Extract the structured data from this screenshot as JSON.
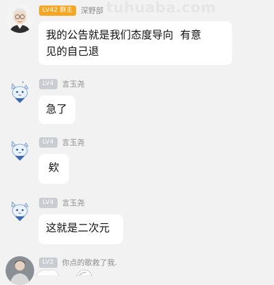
{
  "watermark": "tuhuaba.com",
  "messages": [
    {
      "level": "LV42 群主",
      "level_color": "#f5a623",
      "nickname": "深野部",
      "text": "我的公告就是我们态度导向  有意\n见的自己退",
      "avatar": "old-man-avatar-icon"
    },
    {
      "level": "LV4",
      "level_color": "#c9ccd1",
      "nickname": "言玉尧",
      "text": "急了",
      "avatar": "anime-cat-avatar-icon"
    },
    {
      "level": "LV4",
      "level_color": "#c9ccd1",
      "nickname": "言玉尧",
      "text": "欸",
      "avatar": "anime-cat-avatar-icon"
    },
    {
      "level": "LV4",
      "level_color": "#c9ccd1",
      "nickname": "言玉尧",
      "text": "这就是二次元",
      "avatar": "anime-cat-avatar-icon"
    },
    {
      "level": "LV2",
      "level_color": "#c9ccd1",
      "nickname": "你点的歌救了我.",
      "avatar": "photo-avatar-icon"
    }
  ]
}
